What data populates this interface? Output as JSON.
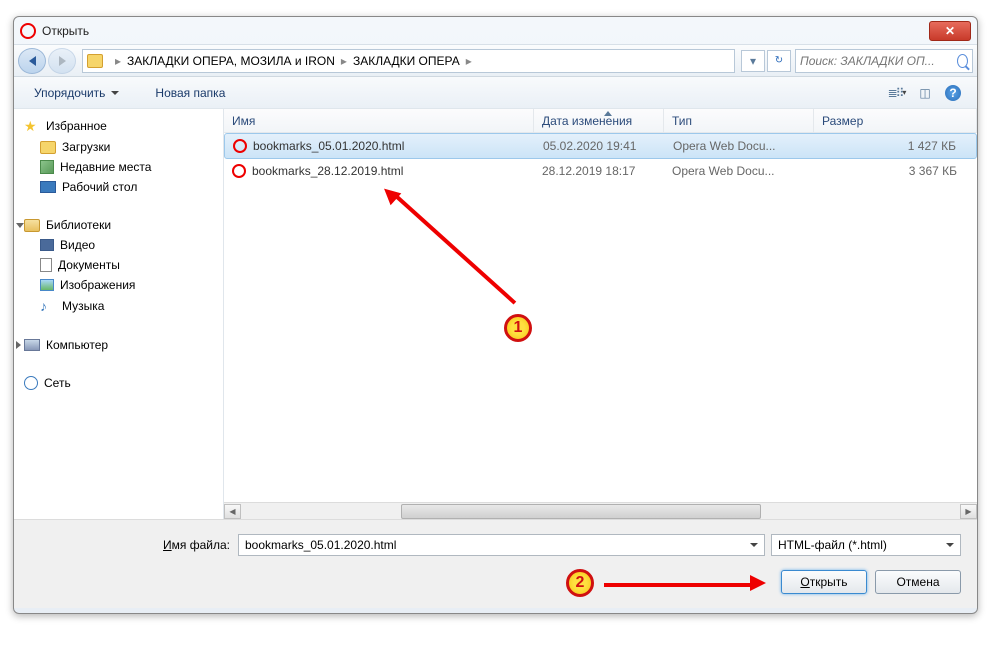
{
  "window": {
    "title": "Открыть"
  },
  "breadcrumb": {
    "items": [
      "ЗАКЛАДКИ ОПЕРА,  МОЗИЛА и IRON",
      "ЗАКЛАДКИ ОПЕРА"
    ]
  },
  "search": {
    "placeholder": "Поиск: ЗАКЛАДКИ ОП..."
  },
  "toolbar": {
    "organize": "Упорядочить",
    "new_folder": "Новая папка"
  },
  "sidebar": {
    "favorites": "Избранное",
    "downloads": "Загрузки",
    "recent": "Недавние места",
    "desktop": "Рабочий стол",
    "libraries": "Библиотеки",
    "videos": "Видео",
    "documents": "Документы",
    "images": "Изображения",
    "music": "Музыка",
    "computer": "Компьютер",
    "network": "Сеть"
  },
  "columns": {
    "name": "Имя",
    "date": "Дата изменения",
    "type": "Тип",
    "size": "Размер"
  },
  "files": [
    {
      "name": "bookmarks_05.01.2020.html",
      "date": "05.02.2020 19:41",
      "type": "Opera Web Docu...",
      "size": "1 427 КБ",
      "selected": true
    },
    {
      "name": "bookmarks_28.12.2019.html",
      "date": "28.12.2019 18:17",
      "type": "Opera Web Docu...",
      "size": "3 367 КБ",
      "selected": false
    }
  ],
  "footer": {
    "label_prefix": "И",
    "label_rest": "мя файла:",
    "filename": "bookmarks_05.01.2020.html",
    "filter": "HTML-файл (*.html)",
    "open_prefix": "О",
    "open_rest": "ткрыть",
    "cancel": "Отмена"
  },
  "annotations": {
    "badge1": "1",
    "badge2": "2"
  }
}
